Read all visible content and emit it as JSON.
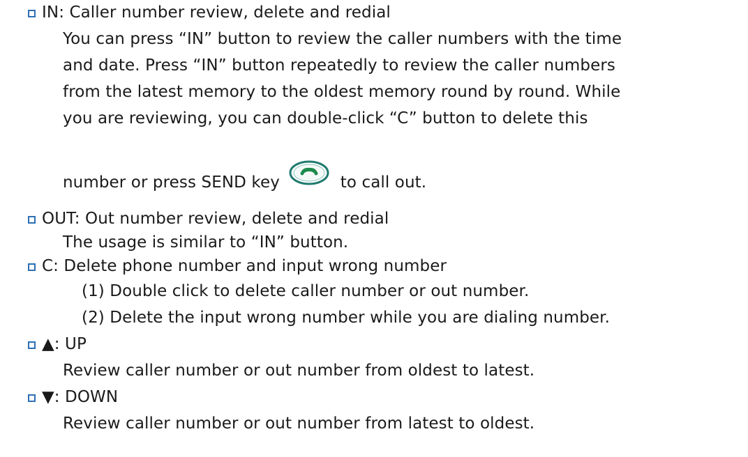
{
  "items": [
    {
      "heading": "IN: Caller number review, delete and redial",
      "body": [
        "You can press “IN” button to review the caller numbers with the time",
        "and date. Press “IN” button repeatedly to review the caller numbers",
        "from the latest memory to the oldest memory round by round. While",
        "you are reviewing, you can double-click “C” button to delete this"
      ],
      "last_line_before": "number or press SEND key",
      "last_line_after": "to call out."
    },
    {
      "heading": "OUT: Out number review, delete and redial",
      "body": [
        "The usage is similar to “IN” button."
      ]
    },
    {
      "heading": "C: Delete phone number and input wrong number",
      "body": [
        "(1)  Double click to delete caller number or out number.",
        "(2)  Delete the input wrong number while you are dialing number."
      ]
    },
    {
      "heading": "▲: UP",
      "body": [
        "Review caller number or out number from oldest to latest."
      ]
    },
    {
      "heading": "▼: DOWN",
      "body": [
        "Review caller number or out number from latest to oldest."
      ]
    }
  ],
  "colors": {
    "bullet": "#2e6fb5",
    "text": "#1a1a1a",
    "send_key_outline": "#1f7a6f",
    "send_key_handset": "#1c8a4c"
  },
  "icons": {
    "bullet": "square-bullet-icon",
    "send_key": "send-key-icon"
  }
}
